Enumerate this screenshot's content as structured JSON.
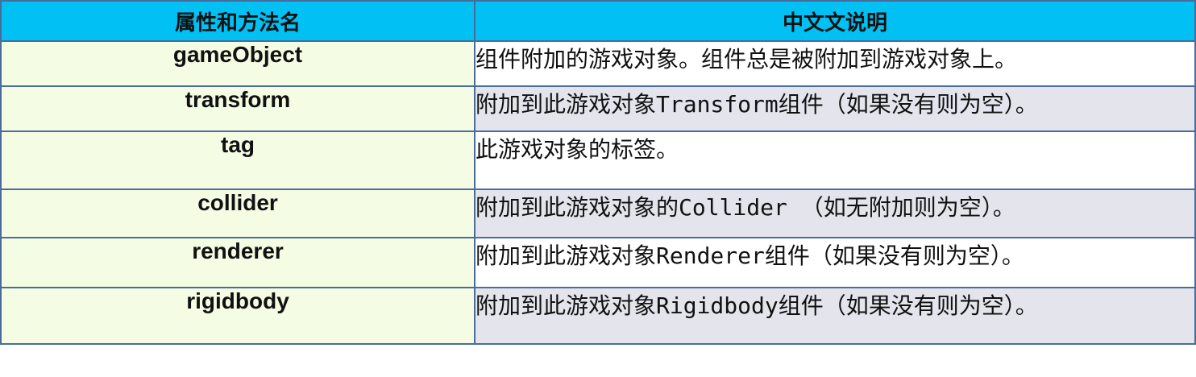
{
  "table": {
    "headers": [
      "属性和方法名",
      "中文文说明"
    ],
    "rows": [
      {
        "name": "gameObject",
        "desc": "组件附加的游戏对象。组件总是被附加到游戏对象上。"
      },
      {
        "name": "transform",
        "desc": "附加到此游戏对象Transform组件（如果没有则为空）。"
      },
      {
        "name": "tag",
        "desc": "此游戏对象的标签。"
      },
      {
        "name": "collider",
        "desc": "附加到此游戏对象的Collider （如无附加则为空）。"
      },
      {
        "name": "renderer",
        "desc": "附加到此游戏对象Renderer组件（如果没有则为空）。"
      },
      {
        "name": "rigidbody",
        "desc": "附加到此游戏对象Rigidbody组件（如果没有则为空）。"
      }
    ]
  },
  "colors": {
    "header_bg": "#00c0f4",
    "name_col_bg": "#f5fce4",
    "desc_alt_bg": "#e4e4ec",
    "border": "#4a6c9b"
  }
}
